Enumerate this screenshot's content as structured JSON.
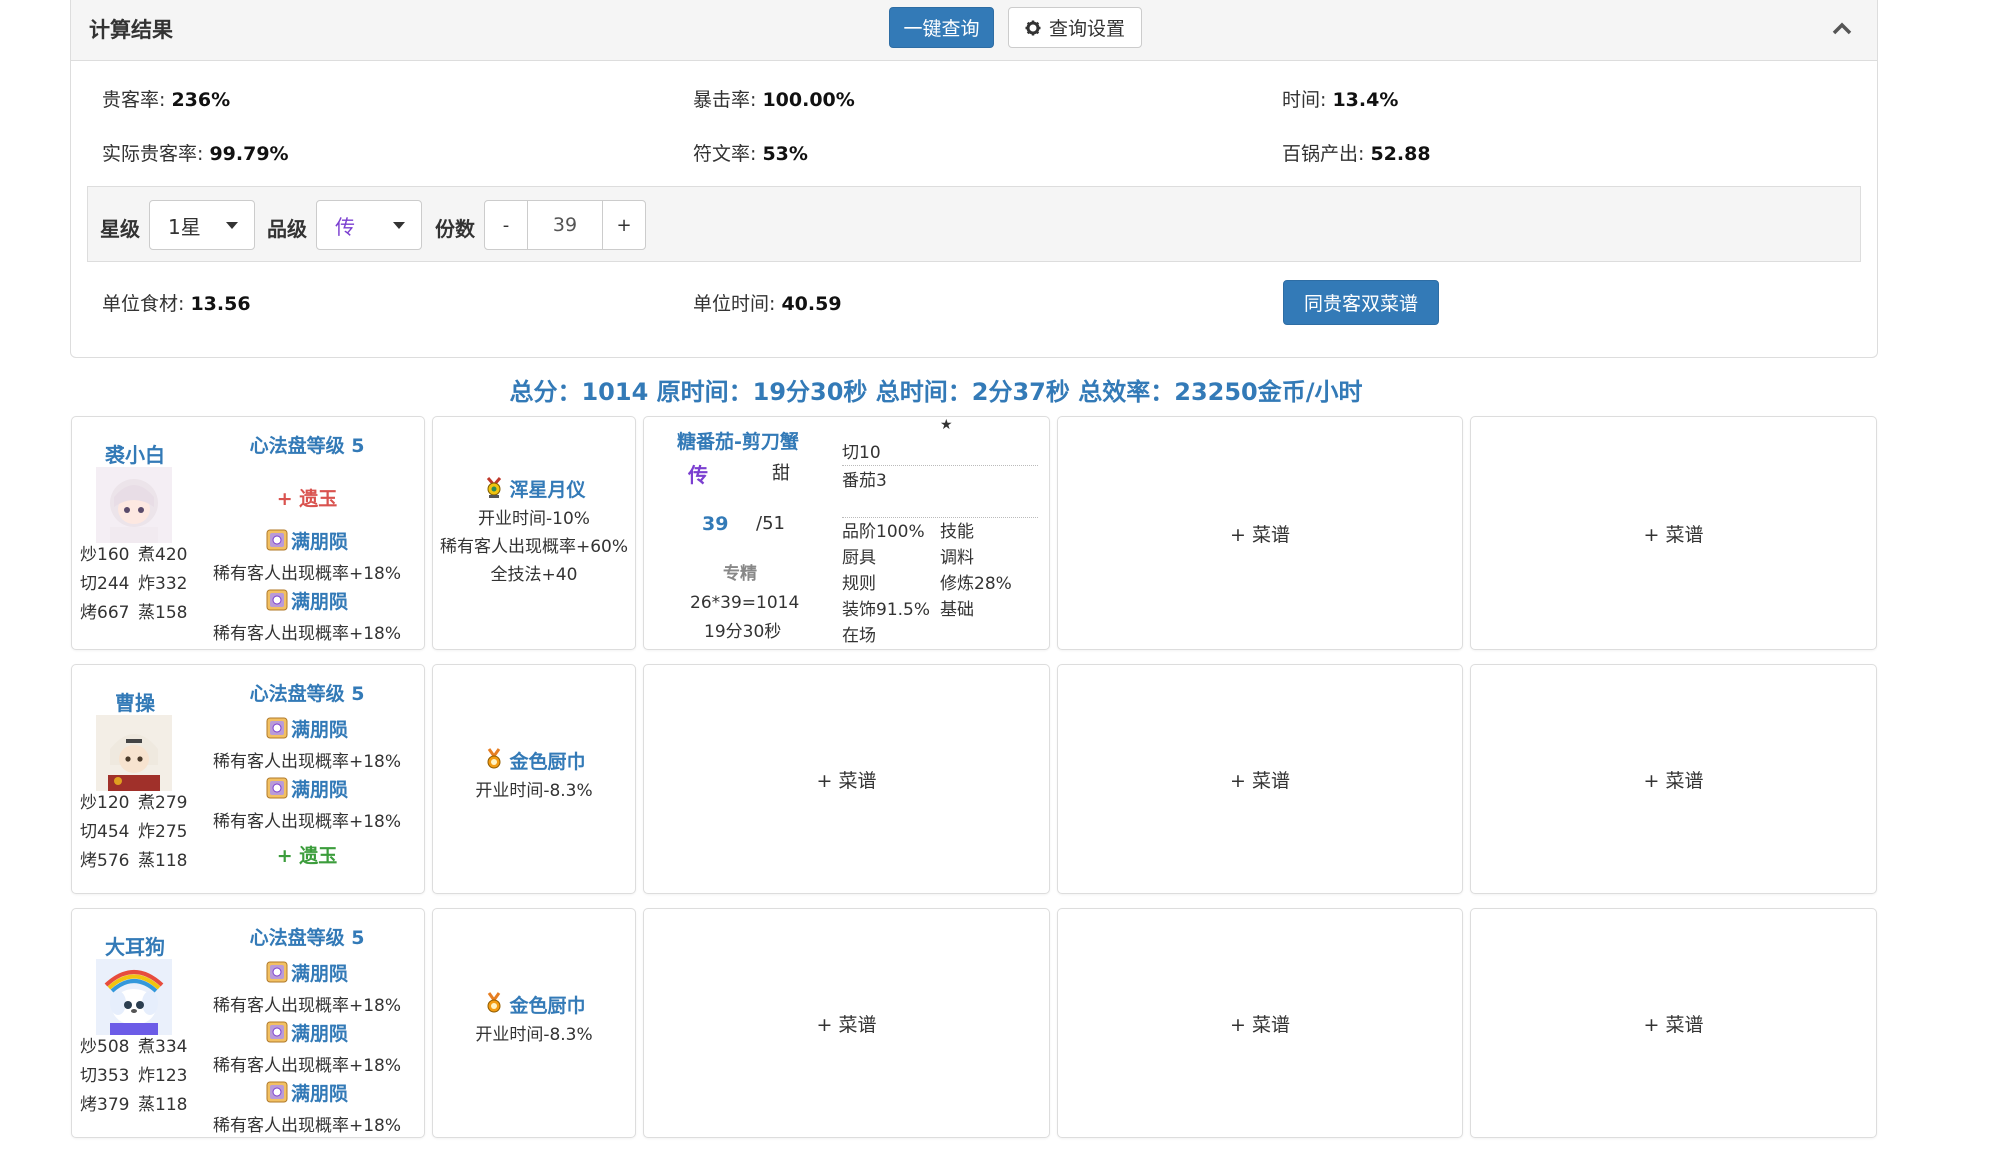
{
  "panel": {
    "title": "计算结果",
    "query_button": "一键查询",
    "settings_button": "查询设置"
  },
  "stats": {
    "guest_rate_label": "贵客率:",
    "guest_rate": "236%",
    "crit_label": "暴击率:",
    "crit": "100.00%",
    "time_label": "时间:",
    "time": "13.4%",
    "actual_guest_label": "实际贵客率:",
    "actual_guest": "99.79%",
    "rune_label": "符文率:",
    "rune": "53%",
    "pot_label": "百锅产出:",
    "pot": "52.88",
    "unit_food_label": "单位食材:",
    "unit_food": "13.56",
    "unit_time_label": "单位时间:",
    "unit_time": "40.59"
  },
  "filters": {
    "star_label": "星级",
    "star_value": "1星",
    "grade_label": "品级",
    "grade_value": "传",
    "count_label": "份数",
    "count_minus": "-",
    "count_value": "39",
    "count_plus": "+"
  },
  "double_recipe_button": "同贵客双菜谱",
  "summary": "总分：1014 原时间：19分30秒 总时间：2分37秒 总效率：23250金币/小时",
  "chefs": [
    {
      "name": "裘小白",
      "skills": [
        "炒160",
        "煮420",
        "切244",
        "炸332",
        "烤667",
        "蒸158"
      ],
      "level": "心法盘等级 5",
      "jade": "+ 遗玉",
      "runes": [
        {
          "name": "满朋陨",
          "desc": "稀有客人出现概率+18%"
        },
        {
          "name": "满朋陨",
          "desc": "稀有客人出现概率+18%"
        }
      ],
      "equip": {
        "name": "浑星月仪",
        "lines": [
          "开业时间-10%",
          "稀有客人出现概率+60%",
          "全技法+40"
        ]
      }
    },
    {
      "name": "曹操",
      "skills": [
        "炒120",
        "煮279",
        "切454",
        "炸275",
        "烤576",
        "蒸118"
      ],
      "level": "心法盘等级 5",
      "jade": "+ 遗玉",
      "runes": [
        {
          "name": "满朋陨",
          "desc": "稀有客人出现概率+18%"
        },
        {
          "name": "满朋陨",
          "desc": "稀有客人出现概率+18%"
        }
      ],
      "equip": {
        "name": "金色厨巾",
        "lines": [
          "开业时间-8.3%"
        ]
      }
    },
    {
      "name": "大耳狗",
      "skills": [
        "炒508",
        "煮334",
        "切353",
        "炸123",
        "烤379",
        "蒸118"
      ],
      "level": "心法盘等级 5",
      "runes": [
        {
          "name": "满朋陨",
          "desc": "稀有客人出现概率+18%"
        },
        {
          "name": "满朋陨",
          "desc": "稀有客人出现概率+18%"
        },
        {
          "name": "满朋陨",
          "desc": "稀有客人出现概率+18%"
        }
      ],
      "equip": {
        "name": "金色厨巾",
        "lines": [
          "开业时间-8.3%"
        ]
      }
    }
  ],
  "recipe": {
    "name": "糖番茄-剪刀蟹",
    "grade": "传",
    "taste": "甜",
    "count": "39",
    "max": "/51",
    "specialty": "专精",
    "formula": "26*39=1014",
    "time": "19分30秒",
    "star": "★",
    "ingredients": [
      "切10",
      "番茄3"
    ],
    "attrs_left": [
      "品阶100%",
      "厨具",
      "规则",
      "装饰91.5%",
      "在场"
    ],
    "attrs_right": [
      "技能",
      "调料",
      "修炼28%",
      "基础"
    ]
  },
  "add_recipe_label": "+ 菜谱",
  "colors": {
    "primary": "#337ab7",
    "grade_purple": "#7b3fd0",
    "jade_red": "#d9534f",
    "jade_green": "#3c9d3c"
  }
}
